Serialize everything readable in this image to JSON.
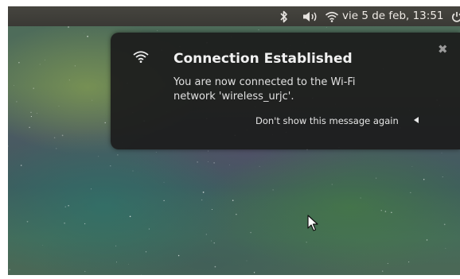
{
  "panel": {
    "clock_text": "vie 5 de feb, 13:51",
    "icons": {
      "bluetooth": "bluetooth-icon",
      "volume": "volume-icon",
      "wifi": "wifi-icon",
      "power": "power-icon"
    }
  },
  "notification": {
    "icon": "wifi-icon",
    "title": "Connection Established",
    "body": "You are now connected to the Wi-Fi network 'wireless_urjc'.",
    "dont_show_label": "Don't show this message again",
    "close_icon": "close-icon",
    "arrow_icon": "triangle-arrow-icon"
  },
  "colors": {
    "panel_bg": "#3c3b37",
    "notification_bg": "#1c1c1c",
    "panel_text": "#e6e3df"
  }
}
